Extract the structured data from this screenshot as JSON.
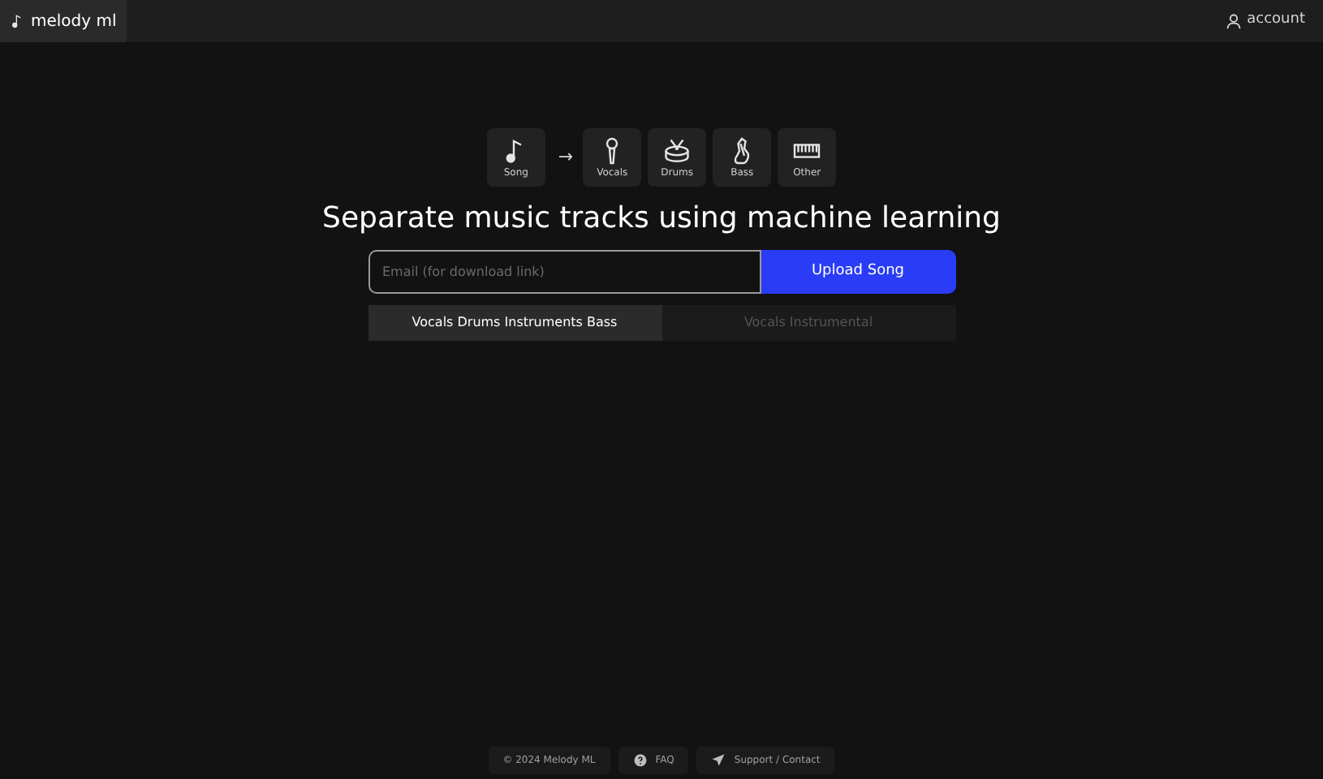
{
  "header": {
    "brand": "melody ml",
    "account": "account"
  },
  "pipeline": {
    "source": {
      "label": "Song",
      "kind": "note"
    },
    "arrow": "→",
    "stems": [
      {
        "label": "Vocals",
        "kind": "mic"
      },
      {
        "label": "Drums",
        "kind": "drum"
      },
      {
        "label": "Bass",
        "kind": "guitar"
      },
      {
        "label": "Other",
        "kind": "keys"
      }
    ]
  },
  "headline": "Separate music tracks using machine learning",
  "form": {
    "email_placeholder": "Email (for download link)",
    "upload_button": "Upload Song"
  },
  "modes": [
    {
      "label": "Vocals Drums Instruments Bass",
      "selected": true
    },
    {
      "label": "Vocals Instrumental",
      "selected": false
    }
  ],
  "footer": [
    {
      "label": "© 2024 Melody ML",
      "kind": "text"
    },
    {
      "label": "FAQ",
      "kind": "faq"
    },
    {
      "label": "Support / Contact",
      "kind": "contact"
    }
  ]
}
